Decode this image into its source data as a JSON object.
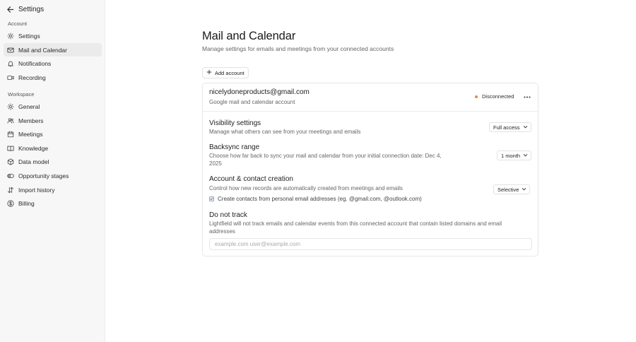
{
  "sidebar": {
    "header": {
      "title": "Settings"
    },
    "sections": [
      {
        "label": "Account",
        "items": [
          {
            "label": "Settings",
            "icon": "gear-icon"
          },
          {
            "label": "Mail and Calendar",
            "icon": "mail-icon",
            "active": true
          },
          {
            "label": "Notifications",
            "icon": "bell-icon"
          },
          {
            "label": "Recording",
            "icon": "video-icon"
          }
        ]
      },
      {
        "label": "Workspace",
        "items": [
          {
            "label": "General",
            "icon": "gear-icon"
          },
          {
            "label": "Members",
            "icon": "users-icon"
          },
          {
            "label": "Meetings",
            "icon": "calendar-icon"
          },
          {
            "label": "Knowledge",
            "icon": "book-icon"
          },
          {
            "label": "Data model",
            "icon": "cube-icon"
          },
          {
            "label": "Opportunity stages",
            "icon": "toggle-icon"
          },
          {
            "label": "Import history",
            "icon": "import-icon"
          },
          {
            "label": "Billing",
            "icon": "dollar-icon"
          }
        ]
      }
    ]
  },
  "main": {
    "title": "Mail and Calendar",
    "subtitle": "Manage settings for emails and meetings from your connected accounts",
    "add_account_label": "Add account",
    "account": {
      "email": "nicelydoneproducts@gmail.com",
      "type": "Google mail and calendar account",
      "status": "Disconnected",
      "status_color": "#e08a4a"
    },
    "visibility": {
      "title": "Visibility settings",
      "desc": "Manage what others can see from your meetings and emails",
      "value": "Full access"
    },
    "backsync": {
      "title": "Backsync range",
      "desc_line1": "Choose how far back to sync your mail and calendar from your initial connection date: Dec 4,",
      "desc_line2": "2025",
      "value": "1 month"
    },
    "contact_creation": {
      "title": "Account & contact creation",
      "desc": "Control how new records are automatically created from meetings and emails",
      "value": "Selective",
      "checkbox_label": "Create contacts from personal email addresses (eg. @gmail.com, @outlook.com)",
      "checkbox_checked": true
    },
    "do_not_track": {
      "title": "Do not track",
      "desc_line1": "Lightfield will not track emails and calendar events from this connected account that contain listed domains and email",
      "desc_line2": "addresses",
      "placeholder": "example.com user@example.com"
    }
  }
}
